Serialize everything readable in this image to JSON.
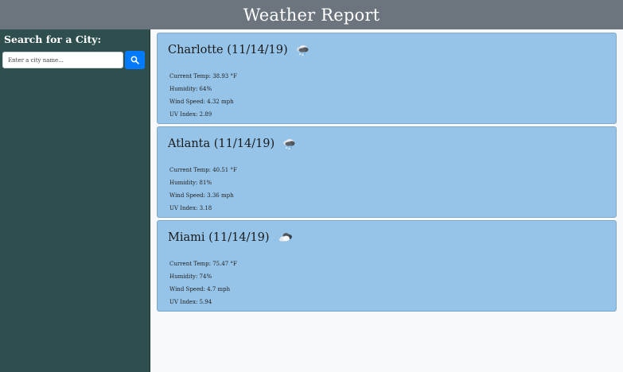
{
  "header": {
    "title": "Weather Report"
  },
  "sidebar": {
    "title": "Search for a City:",
    "search_placeholder": "Enter a city name...",
    "search_icon": "search-icon"
  },
  "cards": [
    {
      "title": "Charlotte (11/14/19)",
      "icon": "rain-snow-cloud-icon",
      "temp": "Current Temp: 38.93 °F",
      "humidity": "Humidity: 64%",
      "wind": "Wind Speed: 4.32 mph",
      "uv": "UV Index: 2.89"
    },
    {
      "title": "Atlanta (11/14/19)",
      "icon": "rain-snow-cloud-icon",
      "temp": "Current Temp: 40.51 °F",
      "humidity": "Humidity: 81%",
      "wind": "Wind Speed: 3.36 mph",
      "uv": "UV Index: 3.18"
    },
    {
      "title": "Miami (11/14/19)",
      "icon": "cloudy-icon",
      "temp": "Current Temp: 75.47 °F",
      "humidity": "Humidity: 74%",
      "wind": "Wind Speed: 4.7 mph",
      "uv": "UV Index: 5.94"
    }
  ],
  "colors": {
    "header_bg": "#6c757d",
    "sidebar_bg": "#2f4f4f",
    "card_bg": "#96c4e8",
    "button_bg": "#007bff",
    "main_bg": "#f8f9fa"
  }
}
